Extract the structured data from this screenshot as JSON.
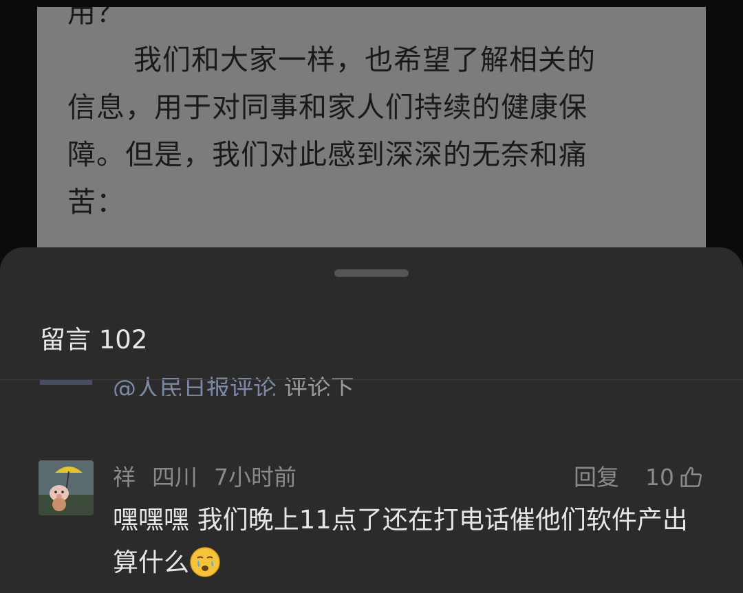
{
  "article": {
    "lines": [
      "用？",
      "我们和大家一样，也希望了解相关的",
      "信息，用于对同事和家人们持续的健康保",
      "障。但是，我们对此感到深深的无奈和痛",
      "苦："
    ]
  },
  "comments_sheet": {
    "title": "留言 102",
    "partial_previous": {
      "mention": "@人民日报评论",
      "text": " 评论下"
    },
    "comment": {
      "username": "祥",
      "location": "四川",
      "time": "7小时前",
      "reply_label": "回复",
      "like_count": "10",
      "text": "嘿嘿嘿   我们晚上11点了还在打电话催他们软件产出算什么",
      "emoji": "crying-emoji"
    }
  },
  "colors": {
    "sheet_bg": "#2b2b2b",
    "article_bg": "#7c7c7c",
    "mention": "#7c8aa6"
  }
}
